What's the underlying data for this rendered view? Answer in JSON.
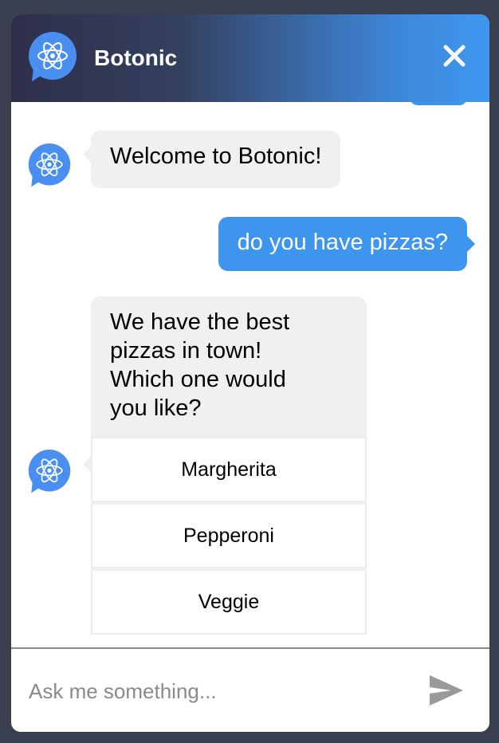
{
  "header": {
    "title": "Botonic",
    "close_icon": "close-icon",
    "avatar_icon": "atom-chat-icon"
  },
  "colors": {
    "header_gradient_start": "#2d2f4a",
    "header_gradient_end": "#3f97f0",
    "user_bubble": "#3e95ee",
    "bot_bubble": "#f0f0f0",
    "avatar": "#4a8ff0",
    "background": "#3a3f50"
  },
  "messages": {
    "welcome": "Welcome to Botonic!",
    "user_question": "do you have pizzas?",
    "pizza_prompt": "We have the best\npizzas in town!\nWhich one would\nyou like?",
    "options": [
      "Margherita",
      "Pepperoni",
      "Veggie"
    ]
  },
  "composer": {
    "placeholder": "Ask me something...",
    "send_icon": "send-icon"
  }
}
